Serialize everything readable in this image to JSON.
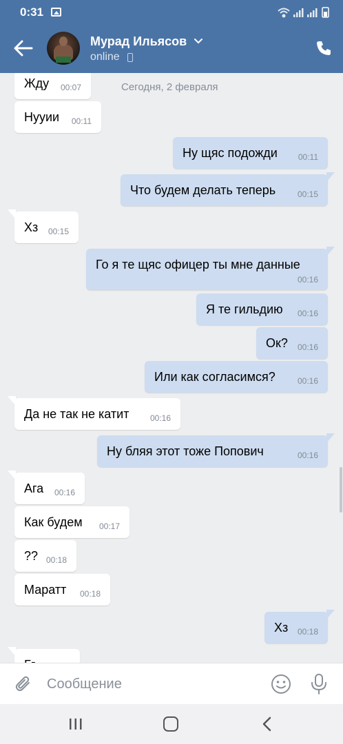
{
  "status_bar": {
    "time": "0:31"
  },
  "header": {
    "contact_name": "Мурад Ильясов",
    "status": "online"
  },
  "chat": {
    "date_separator": "Сегодня, 2 февраля",
    "messages": [
      {
        "dir": "in",
        "text": "Жду",
        "time": "00:07"
      },
      {
        "dir": "in",
        "text": "Нууии",
        "time": "00:11"
      },
      {
        "dir": "out",
        "text": "Ну щяс подожди",
        "time": "00:11"
      },
      {
        "dir": "out",
        "text": "Что будем делать теперь",
        "time": "00:15"
      },
      {
        "dir": "in",
        "text": "Хз",
        "time": "00:15"
      },
      {
        "dir": "out",
        "text": "Го я те щяс офицер ты мне данные",
        "time": "00:16"
      },
      {
        "dir": "out",
        "text": "Я те гильдию",
        "time": "00:16"
      },
      {
        "dir": "out",
        "text": "Ок?",
        "time": "00:16"
      },
      {
        "dir": "out",
        "text": "Или как согласимся?",
        "time": "00:16"
      },
      {
        "dir": "in",
        "text": "Да не так не катит",
        "time": "00:16"
      },
      {
        "dir": "out",
        "text": "Ну бляя этот тоже Попович",
        "time": "00:16"
      },
      {
        "dir": "in",
        "text": "Ага",
        "time": "00:16"
      },
      {
        "dir": "in",
        "text": "Как будем",
        "time": "00:17"
      },
      {
        "dir": "in",
        "text": "??",
        "time": "00:18"
      },
      {
        "dir": "in",
        "text": "Маратт",
        "time": "00:18"
      },
      {
        "dir": "out",
        "text": "Хз",
        "time": "00:18"
      },
      {
        "dir": "in",
        "text": "Гг",
        "time": ""
      }
    ]
  },
  "input": {
    "placeholder": "Сообщение"
  },
  "icons": {
    "back": "arrow-left-icon",
    "call": "phone-icon",
    "attach": "paperclip-icon",
    "emoji": "smiley-icon",
    "mic": "microphone-icon",
    "nav_recents": "recents-icon",
    "nav_home": "home-icon",
    "nav_back": "chevron-left-icon"
  },
  "colors": {
    "header": "#4b74a6",
    "background": "#edeef0",
    "incoming_bubble": "#ffffff",
    "outgoing_bubble": "#cddcf0"
  }
}
